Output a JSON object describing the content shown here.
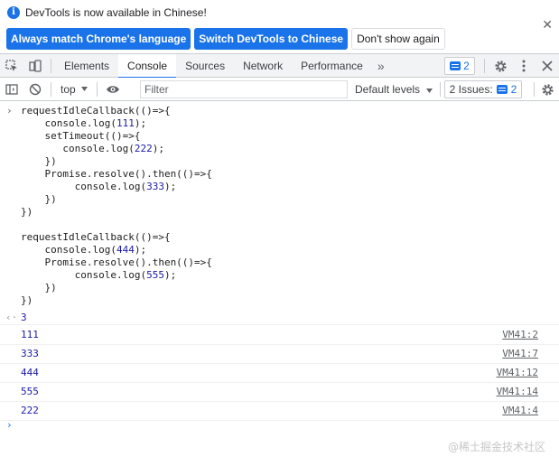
{
  "infobar": {
    "message": "DevTools is now available in Chinese!",
    "btn_match": "Always match Chrome's language",
    "btn_switch": "Switch DevTools to Chinese",
    "btn_dismiss": "Don't show again",
    "close_glyph": "✕"
  },
  "tabs": {
    "items": [
      "Elements",
      "Console",
      "Sources",
      "Network",
      "Performance"
    ],
    "active": "Console",
    "overflow": "»",
    "message_count": "2"
  },
  "console_toolbar": {
    "context": "top",
    "filter_placeholder": "Filter",
    "levels": "Default levels",
    "issues_label": "2 Issues:",
    "issues_count": "2"
  },
  "console": {
    "input_lines": [
      "requestIdleCallback(()=>{",
      "    console.log(111);",
      "    setTimeout(()=>{",
      "       console.log(222);",
      "    })",
      "    Promise.resolve().then(()=>{",
      "         console.log(333);",
      "    })",
      "})",
      "",
      "requestIdleCallback(()=>{",
      "    console.log(444);",
      "    Promise.resolve().then(()=>{",
      "         console.log(555);",
      "    })",
      "})"
    ],
    "result": "3",
    "logs": [
      {
        "value": "111",
        "source": "VM41:2"
      },
      {
        "value": "333",
        "source": "VM41:7"
      },
      {
        "value": "444",
        "source": "VM41:12"
      },
      {
        "value": "555",
        "source": "VM41:14"
      },
      {
        "value": "222",
        "source": "VM41:4"
      }
    ]
  },
  "watermark": "@稀土掘金技术社区",
  "colors": {
    "accent": "#1a73e8",
    "number": "#1a1aa6",
    "border": "#cacdd1"
  }
}
